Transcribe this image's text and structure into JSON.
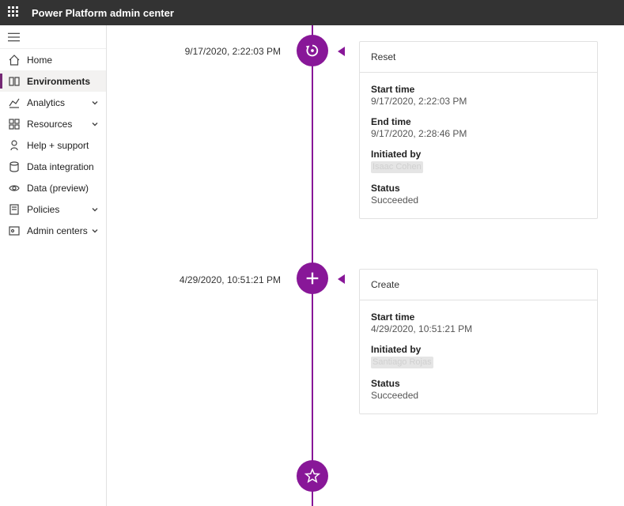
{
  "header": {
    "title": "Power Platform admin center"
  },
  "sidebar": {
    "items": [
      {
        "label": "Home",
        "expandable": false
      },
      {
        "label": "Environments",
        "expandable": false
      },
      {
        "label": "Analytics",
        "expandable": true
      },
      {
        "label": "Resources",
        "expandable": true
      },
      {
        "label": "Help + support",
        "expandable": false
      },
      {
        "label": "Data integration",
        "expandable": false
      },
      {
        "label": "Data (preview)",
        "expandable": false
      },
      {
        "label": "Policies",
        "expandable": true
      },
      {
        "label": "Admin centers",
        "expandable": true
      }
    ]
  },
  "timeline": {
    "events": [
      {
        "timestamp": "9/17/2020, 2:22:03 PM",
        "title": "Reset",
        "fields": {
          "start_label": "Start time",
          "start_value": "9/17/2020, 2:22:03 PM",
          "end_label": "End time",
          "end_value": "9/17/2020, 2:28:46 PM",
          "initiated_label": "Initiated by",
          "initiated_value": "Isaac Cohen",
          "status_label": "Status",
          "status_value": "Succeeded"
        }
      },
      {
        "timestamp": "4/29/2020, 10:51:21 PM",
        "title": "Create",
        "fields": {
          "start_label": "Start time",
          "start_value": "4/29/2020, 10:51:21 PM",
          "initiated_label": "Initiated by",
          "initiated_value": "Santiago Rojas",
          "status_label": "Status",
          "status_value": "Succeeded"
        }
      }
    ]
  }
}
